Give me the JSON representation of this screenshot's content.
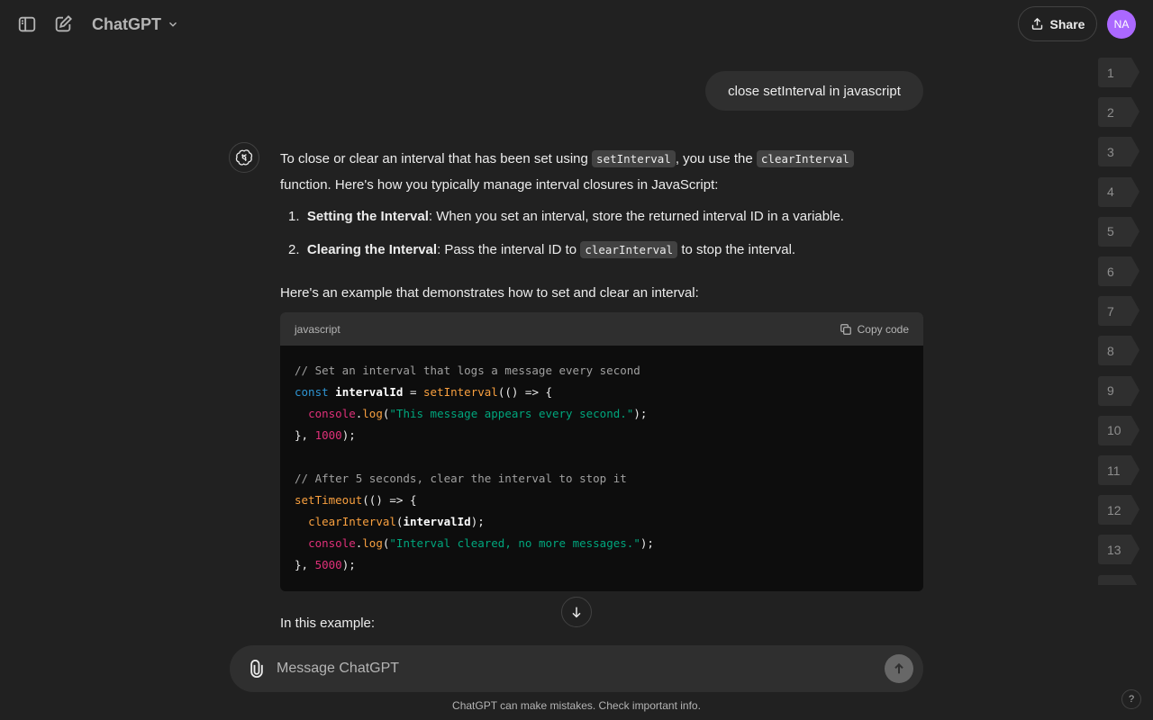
{
  "header": {
    "model_name": "ChatGPT",
    "share_label": "Share",
    "avatar_initials": "NA"
  },
  "nav_numbers": [
    "1",
    "2",
    "3",
    "4",
    "5",
    "6",
    "7",
    "8",
    "9",
    "10",
    "11",
    "12",
    "13"
  ],
  "user_message": "close setInterval in javascript",
  "assistant": {
    "intro_a": "To close or clear an interval that has been set using ",
    "intro_code1": "setInterval",
    "intro_b": ", you use the ",
    "intro_code2": "clearInterval",
    "intro_line2": "function. Here's how you typically manage interval closures in JavaScript:",
    "steps": [
      {
        "num": "1.",
        "title": "Setting the Interval",
        "text": ": When you set an interval, store the returned interval ID in a variable."
      },
      {
        "num": "2.",
        "title": "Clearing the Interval",
        "text_a": ": Pass the interval ID to ",
        "code": "clearInterval",
        "text_b": " to stop the interval."
      }
    ],
    "example_intro": "Here's an example that demonstrates how to set and clear an interval:",
    "code_block": {
      "language": "javascript",
      "copy_label": "Copy code",
      "lines": [
        "// Set an interval that logs a message every second",
        "const intervalId = setInterval(() => {",
        "  console.log(\"This message appears every second.\");",
        "}, 1000);",
        "",
        "// After 5 seconds, clear the interval to stop it",
        "setTimeout(() => {",
        "  clearInterval(intervalId);",
        "  console.log(\"Interval cleared, no more messages.\");",
        "}, 5000);"
      ]
    },
    "in_example": "In this example:"
  },
  "composer": {
    "placeholder": "Message ChatGPT"
  },
  "disclaimer": "ChatGPT can make mistakes. Check important info.",
  "help_label": "?"
}
